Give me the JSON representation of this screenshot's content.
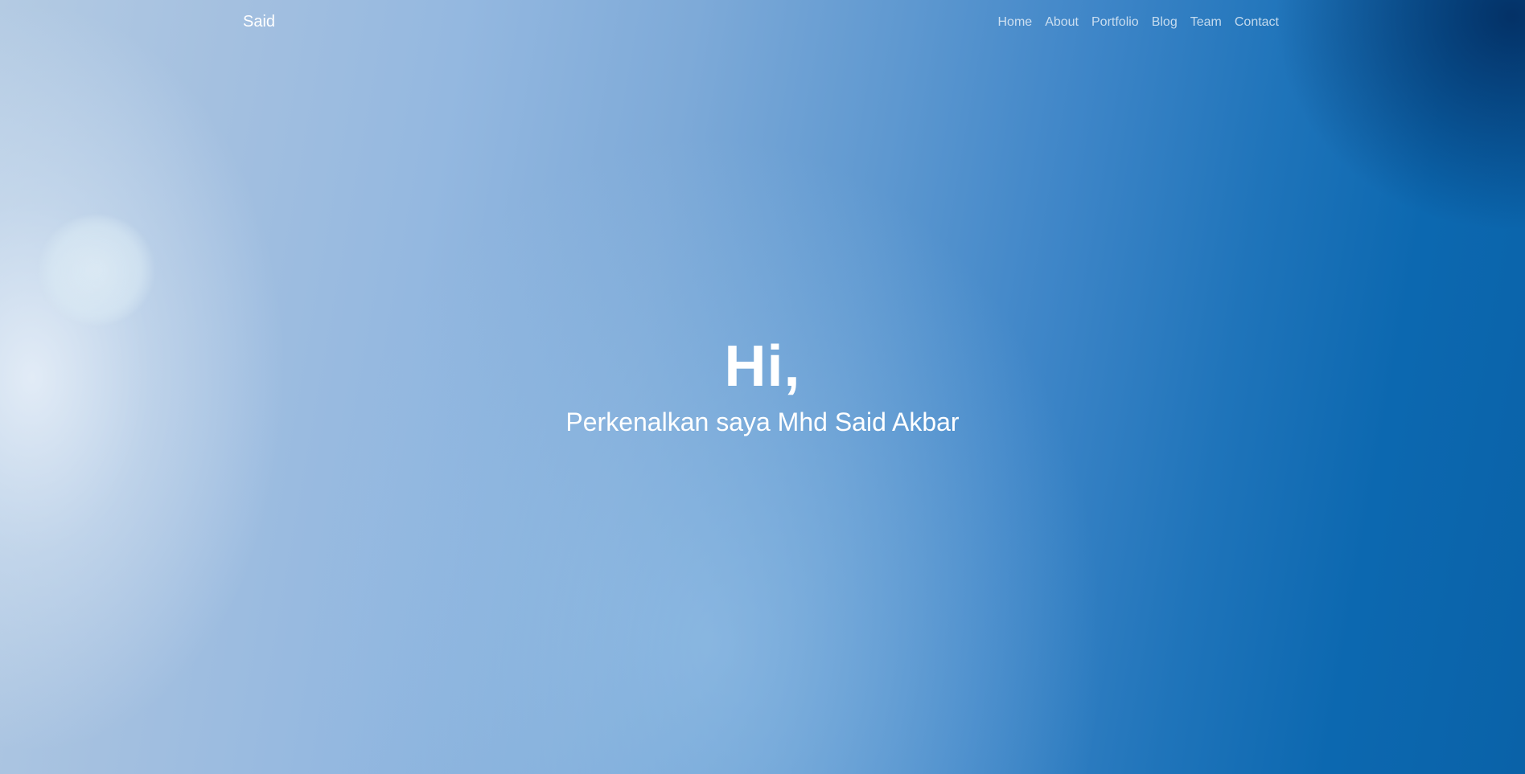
{
  "navbar": {
    "brand": "Said",
    "links": [
      {
        "label": "Home"
      },
      {
        "label": "About"
      },
      {
        "label": "Portfolio"
      },
      {
        "label": "Blog"
      },
      {
        "label": "Team"
      },
      {
        "label": "Contact"
      }
    ]
  },
  "hero": {
    "title": "Hi,",
    "subtitle": "Perkenalkan saya Mhd Said Akbar"
  },
  "colors": {
    "background_light": "#b4cbe3",
    "background_dark": "#0a62a8",
    "text": "#ffffff"
  }
}
